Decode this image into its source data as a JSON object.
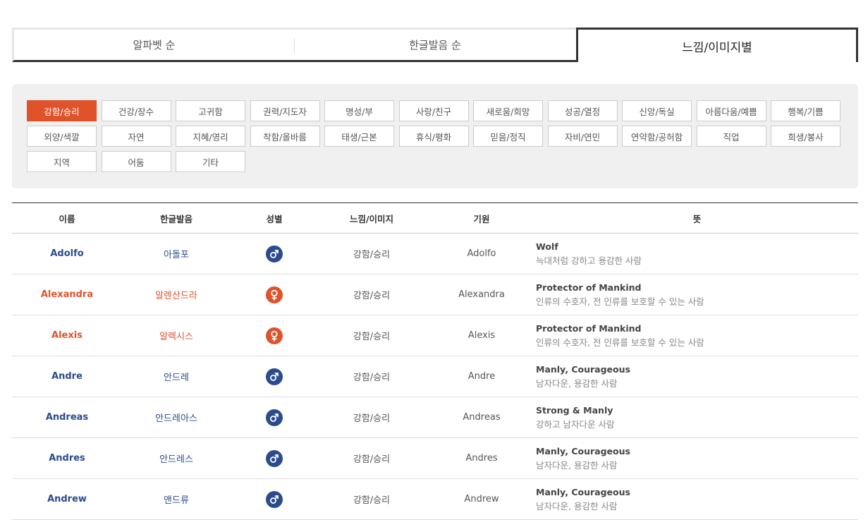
{
  "tabs": [
    "알파벳 순",
    "한글발음 순",
    "느낌/이미지별"
  ],
  "categories": [
    "강함/승리",
    "건강/장수",
    "고귀함",
    "권력/지도자",
    "명성/부",
    "사랑/친구",
    "새로움/희망",
    "성공/열정",
    "신앙/독실",
    "아름다움/예쁨",
    "행복/기쁨",
    "외양/색깔",
    "자연",
    "지혜/영리",
    "착함/올바름",
    "태생/근본",
    "휴식/평화",
    "믿음/정직",
    "자비/연민",
    "연약함/공허함",
    "직업",
    "희생/봉사",
    "지역",
    "어둠",
    "기타"
  ],
  "active_category": "강함/승리",
  "table": {
    "headers": [
      "이름",
      "한글발음",
      "성별",
      "느낌/이미지",
      "기원",
      "뜻"
    ],
    "rows": [
      {
        "name": "Adolfo",
        "kor": "아돌포",
        "gender": "male",
        "feel": "강함/승리",
        "origin": "Adolfo",
        "meaning": "Wolf",
        "desc": "늑대처럼 강하고 용감한 사람"
      },
      {
        "name": "Alexandra",
        "kor": "알렌산드라",
        "gender": "female",
        "feel": "강함/승리",
        "origin": "Alexandra",
        "meaning": "Protector of Mankind",
        "desc": "인류의 수호자, 전 인류를 보호할 수 있는 사람"
      },
      {
        "name": "Alexis",
        "kor": "알렉시스",
        "gender": "female",
        "feel": "강함/승리",
        "origin": "Alexis",
        "meaning": "Protector of Mankind",
        "desc": "인류의 수호자, 전 인류를 보호할 수 있는 사람"
      },
      {
        "name": "Andre",
        "kor": "안드레",
        "gender": "male",
        "feel": "강함/승리",
        "origin": "Andre",
        "meaning": "Manly, Courageous",
        "desc": "남자다운, 용감한 사람"
      },
      {
        "name": "Andreas",
        "kor": "안드레아스",
        "gender": "male",
        "feel": "강함/승리",
        "origin": "Andreas",
        "meaning": "Strong & Manly",
        "desc": "강하고 남자다운 사람"
      },
      {
        "name": "Andres",
        "kor": "안드레스",
        "gender": "male",
        "feel": "강함/승리",
        "origin": "Andres",
        "meaning": "Manly, Courageous",
        "desc": "남자다운, 용감한 사람"
      },
      {
        "name": "Andrew",
        "kor": "앤드류",
        "gender": "male",
        "feel": "강함/승리",
        "origin": "Andrew",
        "meaning": "Manly, Courageous",
        "desc": "남자다운, 용감한 사람"
      }
    ]
  },
  "colors": {
    "male": "#2a4b8d",
    "female": "#e0522a",
    "accent": "#e0522a"
  }
}
